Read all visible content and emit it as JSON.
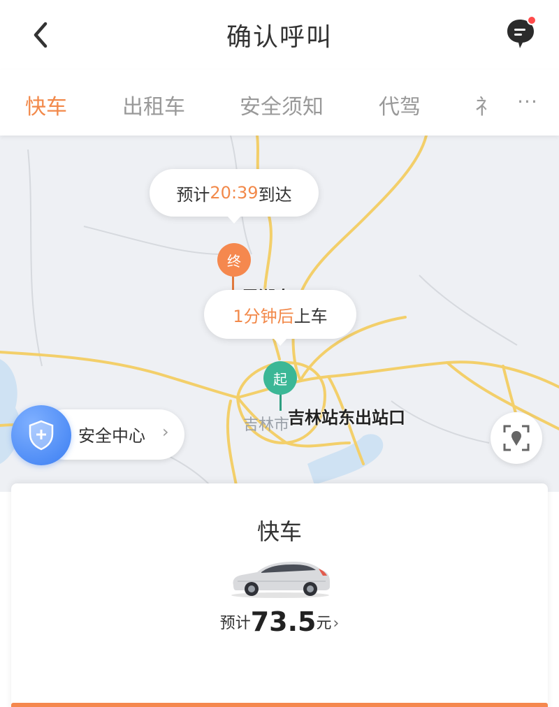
{
  "header": {
    "title": "确认呼叫",
    "back_icon": "chevron-left-icon",
    "message_icon": "message-icon",
    "has_unread": true
  },
  "tabs": [
    {
      "label": "快车",
      "active": true
    },
    {
      "label": "出租车",
      "active": false
    },
    {
      "label": "安全须知",
      "active": false
    },
    {
      "label": "代驾",
      "active": false
    },
    {
      "label": "礻",
      "active": false
    }
  ],
  "tabs_more": "···",
  "map": {
    "eta_bubble": {
      "prefix": "预计",
      "time": "20:39",
      "suffix": "到达"
    },
    "end_pin": {
      "label": "终",
      "place_label": "雷湖岛"
    },
    "pickup_bubble": {
      "time": "1分钟后",
      "suffix": "上车"
    },
    "start_pin": {
      "label": "起",
      "place_label": "吉林站东出站口"
    },
    "city_label": "吉林市",
    "safety": {
      "label": "安全中心",
      "chevron": "›"
    }
  },
  "card": {
    "title": "快车",
    "price_prefix": "预计",
    "price_value": "73.5",
    "price_unit": "元",
    "price_chevron": "›"
  },
  "colors": {
    "accent": "#f2894a",
    "start_green": "#3bb796",
    "end_orange": "#f5884e",
    "safety_blue": "#3b7ef2"
  }
}
